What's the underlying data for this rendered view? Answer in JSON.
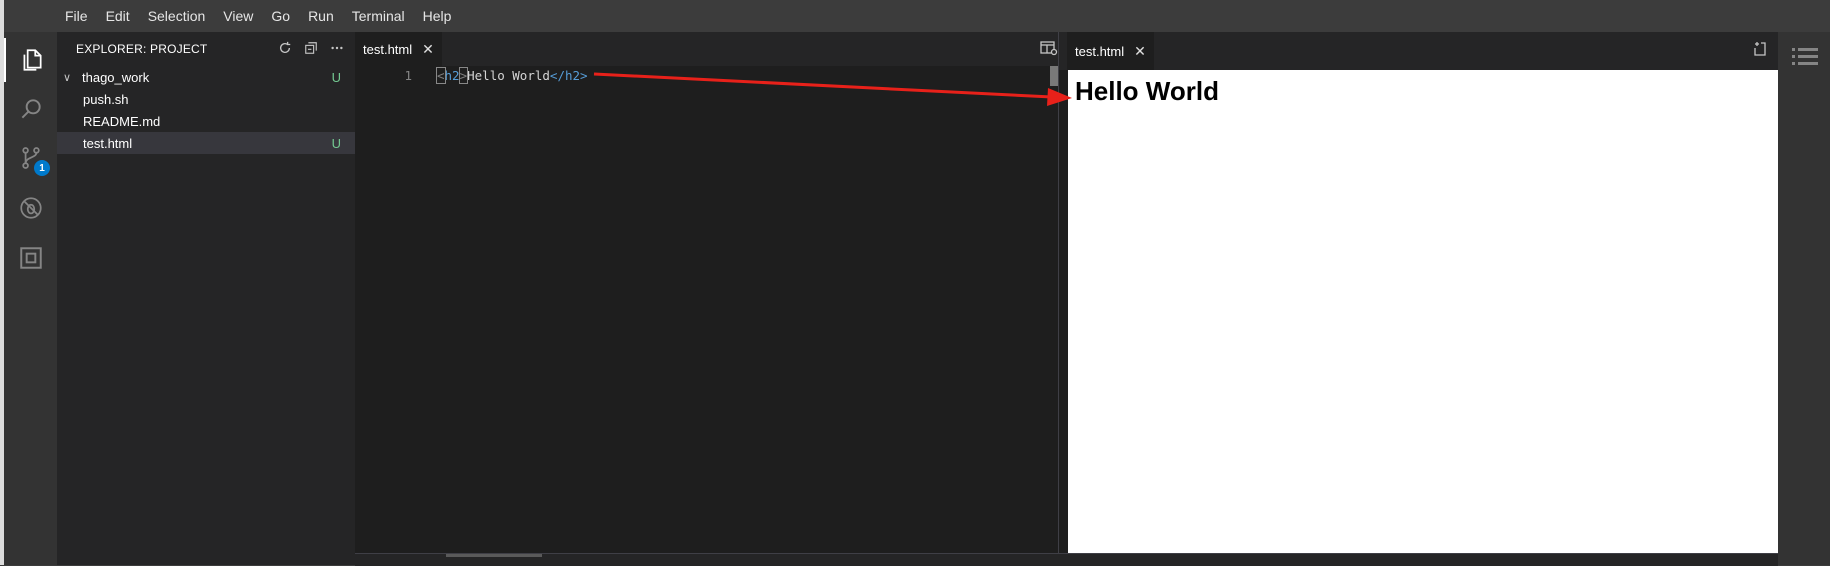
{
  "menu": [
    "File",
    "Edit",
    "Selection",
    "View",
    "Go",
    "Run",
    "Terminal",
    "Help"
  ],
  "activity": {
    "icons": [
      "explorer-icon",
      "search-icon",
      "source-control-icon",
      "debug-icon",
      "extensions-icon"
    ],
    "scm_badge": "1"
  },
  "sidebar": {
    "title": "EXPLORER: PROJECT",
    "folder": {
      "name": "thago_work",
      "status": "U"
    },
    "files": [
      {
        "name": "push.sh",
        "status": ""
      },
      {
        "name": "README.md",
        "status": ""
      },
      {
        "name": "test.html",
        "status": "U"
      }
    ]
  },
  "editor": {
    "tab_label": "test.html",
    "line_number": "1",
    "code": {
      "open_lt": "<",
      "open_tag": "h2",
      "open_gt": ">",
      "text": "Hello World",
      "close_tag": "</h2>"
    }
  },
  "preview": {
    "tab_label": "test.html",
    "heading": "Hello World"
  },
  "colors": {
    "annotation_arrow": "#e8211a",
    "git_untracked": "#73c991",
    "badge": "#007acc"
  }
}
